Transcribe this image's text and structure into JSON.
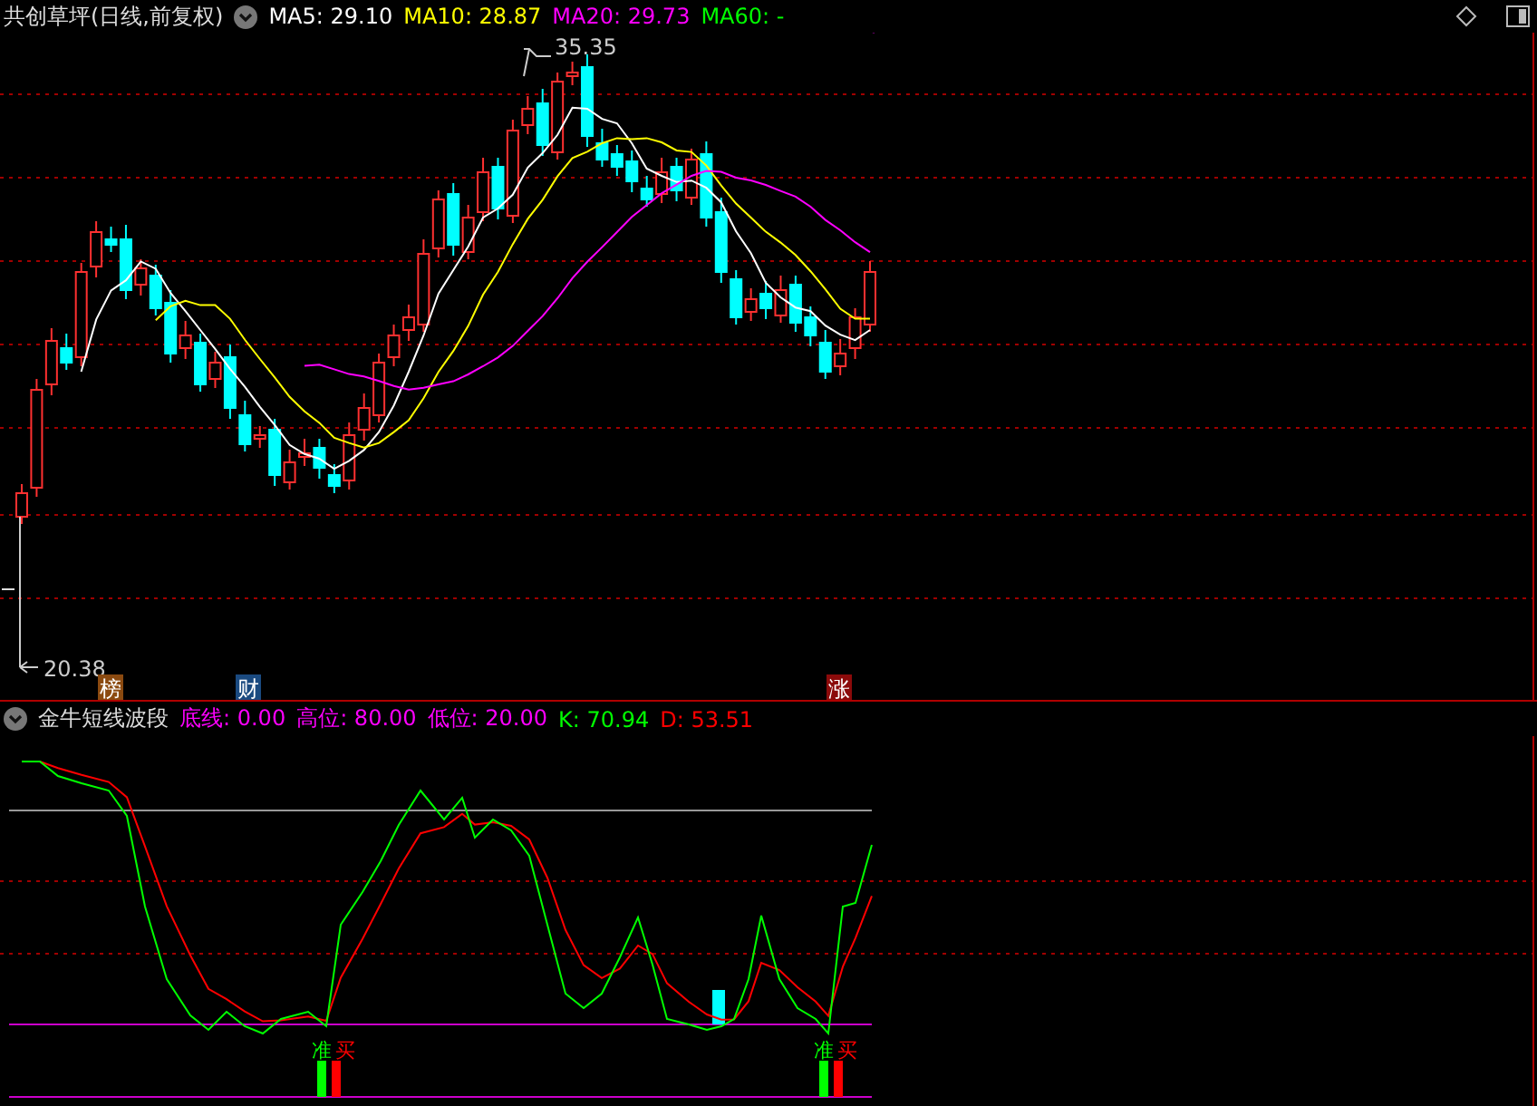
{
  "price_panel": {
    "title": "共创草坪(日线,前复权)",
    "indicators": [
      {
        "label": "MA5: 29.10",
        "color": "#ffffff"
      },
      {
        "label": "MA10: 28.87",
        "color": "#ffff00"
      },
      {
        "label": "MA20: 29.73",
        "color": "#ff00ff"
      },
      {
        "label": "MA60: -",
        "color": "#00ff00"
      }
    ],
    "high_label": "35.35",
    "low_label": "20.38",
    "event_badges": [
      {
        "label": "榜",
        "color": "#8b4a10"
      },
      {
        "label": "财",
        "color": "#1a4a80"
      },
      {
        "label": "涨",
        "color": "#8b0a0a"
      }
    ]
  },
  "indicator_panel": {
    "title": "金牛短线波段",
    "values": [
      {
        "label": "底线: 0.00",
        "color": "#ff00ff"
      },
      {
        "label": "高位: 80.00",
        "color": "#ff00ff"
      },
      {
        "label": "低位: 20.00",
        "color": "#ff00ff"
      },
      {
        "label": "K: 70.94",
        "color": "#00ff00"
      },
      {
        "label": "D: 53.51",
        "color": "#ff0000"
      }
    ],
    "signals": [
      {
        "first": "准",
        "second": "买"
      },
      {
        "first": "准",
        "second": "买"
      }
    ]
  }
}
